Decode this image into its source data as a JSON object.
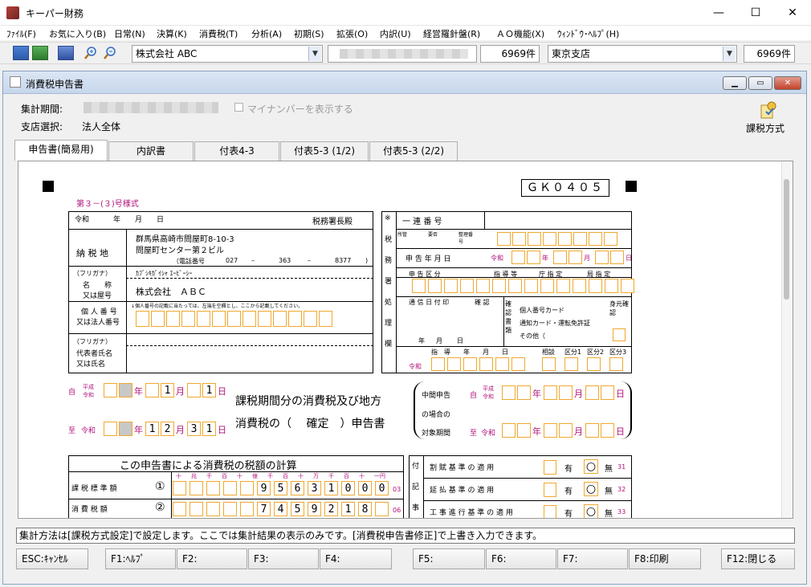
{
  "app": {
    "title": "キーパー財務",
    "min": "—",
    "max": "☐",
    "close": "✕"
  },
  "menu": [
    "ﾌｧｲﾙ(F)",
    "お気に入り(B)",
    "日常(N)",
    "決算(K)",
    "消費税(T)",
    "分析(A)",
    "初期(S)",
    "拡張(O)",
    "内訳(U)",
    "経営羅針盤(R)",
    "ＡＯ機能(X)",
    "ｳｨﾝﾄﾞｳ･ﾍﾙﾌﾟ(H)"
  ],
  "toolbar": {
    "company": "株式会社  ABC",
    "company_count": "6969件",
    "branch": "東京支店",
    "branch_count": "6969件"
  },
  "child": {
    "title": "消費税申告書",
    "period_label": "集計期間:",
    "mynumber_label": "マイナンバーを表示する",
    "branch_label": "支店選択:",
    "branch_value": "法人全体",
    "tax_method": "課税方式",
    "tabs": [
      "申告書(簡易用)",
      "内訳書",
      "付表4-3",
      "付表5-3 (1/2)",
      "付表5-3 (2/2)"
    ]
  },
  "form": {
    "code": "ＧＫ０４０５",
    "style_label": "第３－(３)号様式",
    "era_line": [
      "令和",
      "年",
      "月",
      "日"
    ],
    "office_label": "税務署長殿",
    "address_label": "納 税 地",
    "address1": "群馬県高崎市問屋町8-10-3",
    "address2": "問屋町センター第２ビル",
    "phone_label": "（電話番号",
    "phone_parts": [
      "027",
      "363",
      "8377"
    ],
    "furigana_label": "（フリガナ）",
    "furigana_value": "ｶﾌﾞｼｷｶﾞｲｼｬ ｴｰﾋﾞｰｼｰ",
    "name_label1": "名　　称",
    "name_label2": "又は屋号",
    "name_value": "株式会社　ＡＢＣ",
    "indiv_label1": "個 人 番 号",
    "indiv_label2": "又は法人番号",
    "indiv_note": "↓個人番号の記載に当たっては、左端を空欄とし、ここから記載してください。",
    "rep_label1": "（フリガナ）",
    "rep_label2": "代表者氏名",
    "rep_label3": "又は氏名",
    "office_use_mark": "※",
    "office_use_label": [
      "税",
      "務",
      "署",
      "処",
      "理",
      "欄"
    ],
    "serial_label": "一 連 番 号",
    "small_heads": [
      "所管",
      "要否",
      "整理番号"
    ],
    "filing_date_label": "申 告 年 月 日",
    "reiwa": "令和",
    "y": "年",
    "m": "月",
    "d": "日",
    "filing_class": "申 告 区 分",
    "guide": "指 導 等",
    "office_designate": "庁 指 定",
    "bureau_designate": "局 指 定",
    "comm_label": "通 信 日 付 印",
    "confirm_label": "確 認",
    "confirm_doc": "確認書類",
    "id_card": "個人番号カード",
    "notice_card": "通知カード・運転免許証",
    "other": "その他（",
    "identity": "身元確認",
    "md_label": [
      "年",
      "月",
      "日"
    ],
    "guide_date": [
      "指",
      "導",
      "年",
      "月",
      "日"
    ],
    "consult": [
      "相談",
      "区分1",
      "区分2",
      "区分3"
    ],
    "from_label": "自",
    "to_label": "至",
    "heisei": "平成",
    "from_date": {
      "m": "1",
      "d": "1"
    },
    "to_date": {
      "m": "12",
      "d": "31"
    },
    "title_line1": "課税期間分の消費税及び地方",
    "title_line2": "消費税の（　 確定　）申告書",
    "interim_label1": "中間申告",
    "interim_label2": "の場合の",
    "interim_label3": "対象期間",
    "calc_title": "この申告書による消費税の税額の計算",
    "units": [
      "十",
      "兆",
      "千",
      "百",
      "十",
      "億",
      "千",
      "百",
      "十",
      "万",
      "千",
      "百",
      "十",
      "一円"
    ],
    "row1_label": "課 税 標 準 額",
    "row1_no": "①",
    "row1_digits": [
      "",
      "",
      "",
      "",
      "",
      "9",
      "5",
      "6",
      "3",
      "1",
      "0",
      "0",
      "0"
    ],
    "row1_code": "03",
    "row2_label": "消 費 税 額",
    "row2_no": "②",
    "row2_digits": [
      "",
      "",
      "",
      "",
      "",
      "7",
      "4",
      "5",
      "9",
      "2",
      "1",
      "8",
      ""
    ],
    "row2_code": "06",
    "side_label": [
      "付",
      "記",
      "事"
    ],
    "app_rows": [
      {
        "label": "割 賦 基 準 の 適 用",
        "yes": "有",
        "no": "無",
        "code": "31"
      },
      {
        "label": "延 払 基 準 の 適 用",
        "yes": "有",
        "no": "無",
        "code": "32"
      },
      {
        "label": "工 事 進 行 基 準 の 適 用",
        "yes": "有",
        "no": "無",
        "code": "33"
      }
    ]
  },
  "status": "集計方法は[課税方式設定]で設定します。ここでは集計結果の表示のみです。[消費税申告書修正]で上書き入力できます。",
  "fkeys": [
    "ESC:ｷｬﾝｾﾙ",
    "F1:ﾍﾙﾌﾟ",
    "F2:",
    "F3:",
    "F4:",
    "F5:",
    "F6:",
    "F7:",
    "F8:印刷",
    "F12:閉じる"
  ],
  "colors": {
    "accent": "#b0127a",
    "cell_border": "#f0a830"
  }
}
